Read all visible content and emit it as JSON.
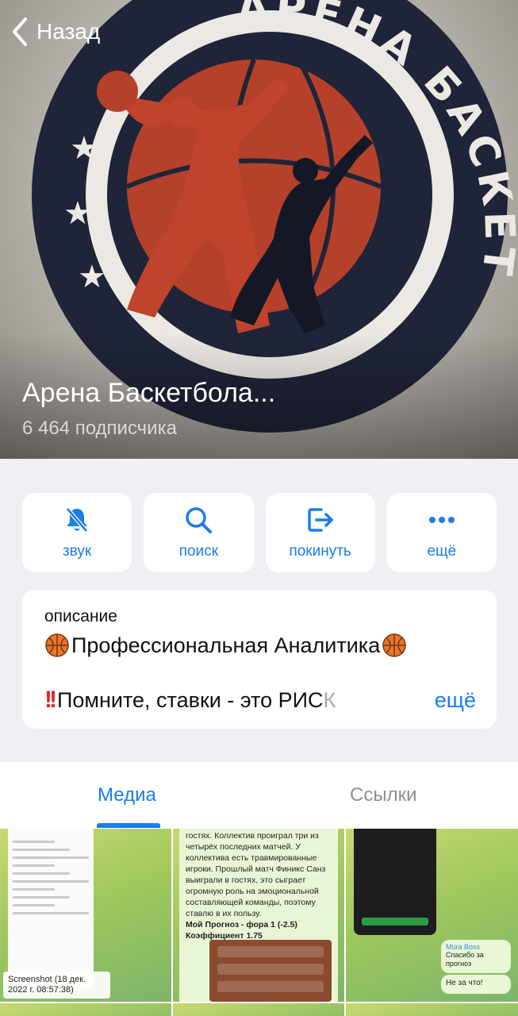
{
  "header": {
    "back_label": "Назад",
    "channel_title": "Арена Баскетбола...",
    "subscribers": "6 464 подписчика",
    "logo_text": "АРЕНА БАСКЕТБОЛА"
  },
  "actions": [
    {
      "label": "звук",
      "icon": "bell-slash-icon"
    },
    {
      "label": "поиск",
      "icon": "search-icon"
    },
    {
      "label": "покинуть",
      "icon": "leave-icon"
    },
    {
      "label": "ещё",
      "icon": "more-dots-icon"
    }
  ],
  "description": {
    "label": "описание",
    "line1": "Профессиональная Аналитика",
    "line2_main": "Помните, ставки - это РИС",
    "line2_fade": "К",
    "more_label": "ещё"
  },
  "tabs": [
    {
      "label": "Медиа",
      "active": true
    },
    {
      "label": "Ссылки",
      "active": false
    }
  ],
  "media": {
    "shot_caption": "Screenshot (18 дек. 2022 г. 08:57:38)",
    "msg_text": "гостях. Коллектив проиграл три из четырёх последних матчей. У коллектива есть травмированные игроки. Прошлый матч Финикс Санз выиграли в гостях, это сыграет огромную роль на эмоциональной составляющей команды, поэтому ставлю в их пользу.",
    "msg_forecast": "Мой Прогноз - фора 1 (-2.5)",
    "msg_coef": "Коэффициент 1.75",
    "chat_name": "Mura Boss",
    "chat_text": "Спасибо за прогноз",
    "chat_reply": "Не за что!"
  },
  "colors": {
    "accent": "#1a7ee8",
    "background": "#efeff4",
    "logo_ring": "#1f2438",
    "logo_ball": "#b5412a"
  }
}
